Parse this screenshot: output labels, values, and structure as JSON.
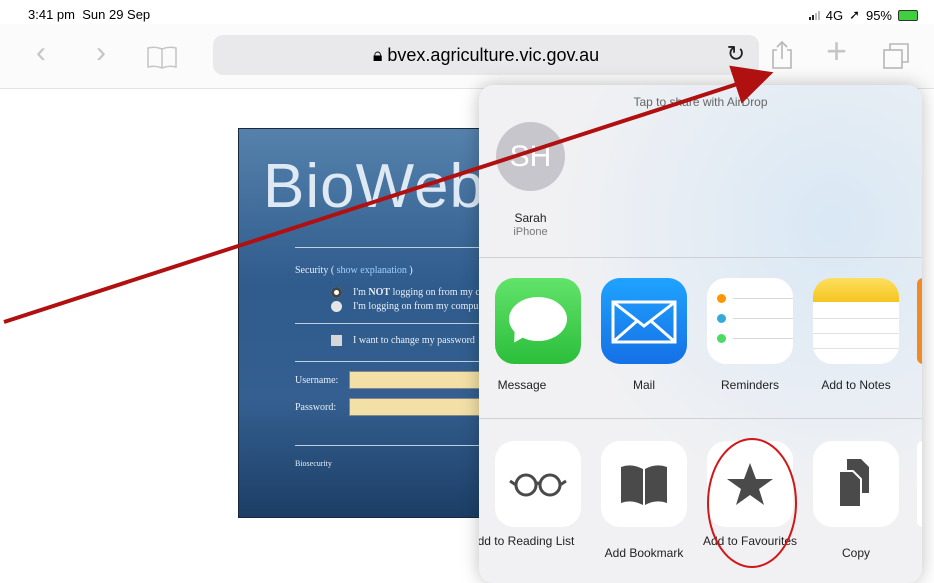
{
  "status_bar": {
    "time": "3:41 pm",
    "date": "Sun 29 Sep",
    "network": "4G",
    "battery": "95%"
  },
  "browser": {
    "url": "bvex.agriculture.vic.gov.au"
  },
  "page": {
    "logo_text": "BioWeb",
    "security_label": "Security (",
    "security_link": "show explanation",
    "security_close": ")",
    "option_not_logging_prefix": "I'm ",
    "option_not_logging_bold": "NOT",
    "option_not_logging_rest": " logging on from my c",
    "option_logging": "I'm logging on from my compu",
    "change_password": "I want to change my password",
    "username_label": "Username:",
    "password_label": "Password:",
    "footer": "Biosecurity"
  },
  "share_sheet": {
    "airdrop_hint": "Tap to share with AirDrop",
    "contact": {
      "initials": "SH",
      "name": "Sarah",
      "device": "iPhone"
    },
    "apps": [
      {
        "label": "Message",
        "icon": "messages-app-icon"
      },
      {
        "label": "Mail",
        "icon": "mail-app-icon"
      },
      {
        "label": "Reminders",
        "icon": "reminders-app-icon"
      },
      {
        "label": "Add to Notes",
        "icon": "notes-app-icon"
      }
    ],
    "actions": [
      {
        "label": "Add to Reading List",
        "icon": "glasses-icon"
      },
      {
        "label": "Add Bookmark",
        "icon": "book-icon"
      },
      {
        "label": "Add to Favourites",
        "icon": "star-icon"
      },
      {
        "label": "Copy",
        "icon": "copy-icon"
      }
    ]
  },
  "colors": {
    "annotation_arrow": "#b01010",
    "annotation_circle": "#d01818",
    "accent": "#007aff"
  }
}
